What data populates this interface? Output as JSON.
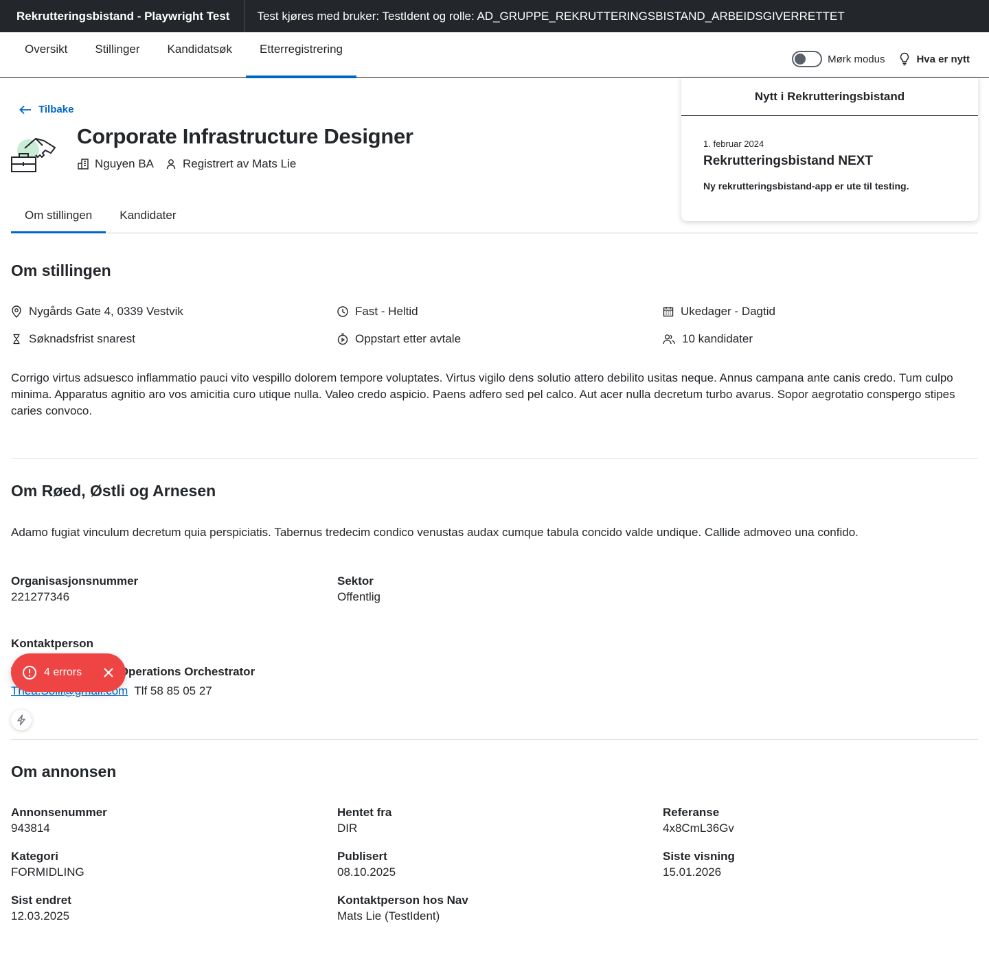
{
  "header": {
    "app_title": "Rekrutteringsbistand - Playwright Test",
    "user_info": "Test kjøres med bruker: TestIdent og rolle: AD_GRUPPE_REKRUTTERINGSBISTAND_ARBEIDSGIVERRETTET"
  },
  "nav": {
    "tabs": [
      "Oversikt",
      "Stillinger",
      "Kandidatsøk",
      "Etterregistrering"
    ],
    "active_tab": "Etterregistrering",
    "dark_mode_label": "Mørk modus",
    "whats_new_label": "Hva er nytt"
  },
  "popover": {
    "title": "Nytt i Rekrutteringsbistand",
    "date": "1. februar 2024",
    "heading": "Rekrutteringsbistand NEXT",
    "description": "Ny rekrutteringsbistand-app er ute til testing."
  },
  "page": {
    "back_label": "Tilbake",
    "title": "Corporate Infrastructure Designer",
    "employer": "Nguyen BA",
    "registered_by": "Registrert av Mats Lie"
  },
  "tabs": [
    "Om stillingen",
    "Kandidater"
  ],
  "about_position": {
    "heading": "Om stillingen",
    "details": {
      "address": "Nygårds Gate 4, 0339 Vestvik",
      "employment": "Fast - Heltid",
      "work_time": "Ukedager - Dagtid",
      "deadline": "Søknadsfrist snarest",
      "start": "Oppstart etter avtale",
      "candidates": "10 kandidater"
    },
    "description": "Corrigo virtus adsuesco inflammatio pauci vito vespillo dolorem tempore voluptates. Virtus vigilo dens solutio attero debilito usitas neque. Annus campana ante canis credo. Tum culpo minima. Apparatus agnitio aro vos amicitia curo utique nulla. Valeo credo aspicio. Paens adfero sed pel calco. Aut acer nulla decretum turbo avarus. Sopor aegrotatio conspergo stipes caries convoco."
  },
  "about_employer": {
    "heading": "Om Røed, Østli og Arnesen",
    "description": "Adamo fugiat vinculum decretum quia perspiciatis. Tabernus tredecim condico venustas audax cumque tabula concido valde undique. Callide admoveo una confido.",
    "org_number_label": "Organisasjonsnummer",
    "org_number": "221277346",
    "sector_label": "Sektor",
    "sector": "Offentlig",
    "contact_heading": "Kontaktperson",
    "contact_name": "Thea Solli - Human Operations Orchestrator",
    "contact_email": "Thea.Solli@gmail.com",
    "contact_phone": "Tlf 58 85 05 27"
  },
  "about_ad": {
    "heading": "Om annonsen",
    "fields": [
      {
        "label": "Annonsenummer",
        "value": "943814"
      },
      {
        "label": "Hentet fra",
        "value": "DIR"
      },
      {
        "label": "Referanse",
        "value": "4x8CmL36Gv"
      },
      {
        "label": "Kategori",
        "value": "FORMIDLING"
      },
      {
        "label": "Publisert",
        "value": "08.10.2025"
      },
      {
        "label": "Siste visning",
        "value": "15.01.2026"
      },
      {
        "label": "Sist endret",
        "value": "12.03.2025"
      },
      {
        "label": "Kontaktperson hos Nav",
        "value": "Mats Lie (TestIdent)"
      }
    ]
  },
  "error_toast": {
    "label": "4 errors"
  },
  "colors": {
    "header_bg": "#23262a",
    "accent": "#0067c5",
    "error": "#ef4444"
  }
}
